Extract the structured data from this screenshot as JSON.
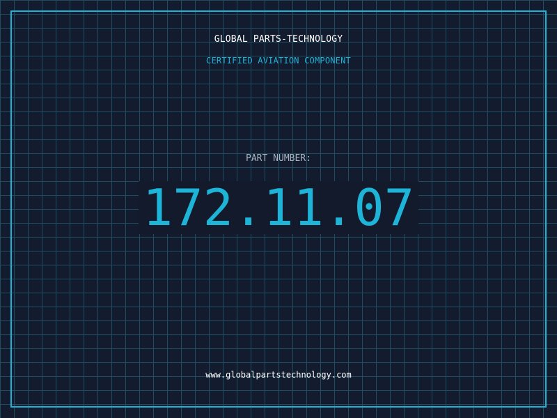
{
  "header": {
    "company": "GLOBAL PARTS-TECHNOLOGY",
    "subtitle": "CERTIFIED AVIATION COMPONENT"
  },
  "part": {
    "label": "PART NUMBER:",
    "number": "172.11.07"
  },
  "footer": {
    "website": "www.globalpartstechnology.com"
  },
  "colors": {
    "background": "#131b2e",
    "grid": "#1f4c5e",
    "accent": "#1eb4d8",
    "text_primary": "#ffffff",
    "text_muted": "#a9b4c2"
  }
}
